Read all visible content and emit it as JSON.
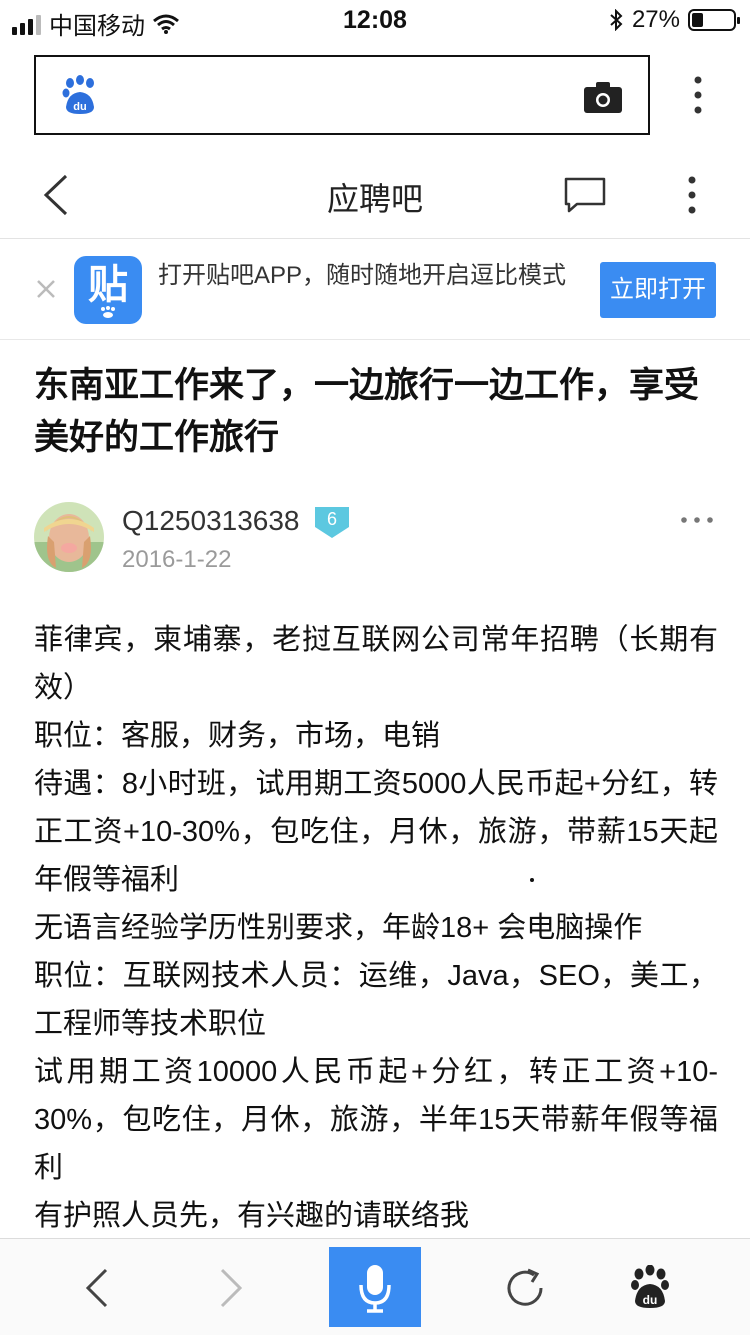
{
  "status_bar": {
    "carrier": "中国移动",
    "time": "12:08",
    "battery": "27%",
    "battery_level": 0.27
  },
  "search_bar": {
    "logo_icon": "baidu-paw-icon",
    "camera_icon": "camera-icon",
    "menu_icon": "more-vertical-icon"
  },
  "nav": {
    "title": "应聘吧",
    "back_icon": "chevron-left-icon",
    "chat_icon": "chat-bubble-icon",
    "more_icon": "more-vertical-icon"
  },
  "banner": {
    "app_icon_char": "贴",
    "text": "打开贴吧APP，随时随地开启逗比模式",
    "open_button": "立即打开"
  },
  "post": {
    "title": "东南亚工作来了，一边旅行一边工作，享受美好的工作旅行",
    "author": "Q1250313638",
    "level": "6",
    "date": "2016-1-22",
    "content": [
      "菲律宾，柬埔寨，老挝互联网公司常年招聘（长期有效）",
      "职位：客服，财务，市场，电销",
      "待遇：8小时班，试用期工资5000人民币起+分红，转正工资+10-30%，包吃住，月休，旅游，带薪15天起年假等福利",
      "无语言经验学历性别要求，年龄18+ 会电脑操作",
      "职位：互联网技术人员：运维，Java，SEO，美工，工程师等技术职位",
      "试用期工资10000人民币起+分红，转正工资+10-30%，包吃住，月休，旅游，半年15天带薪年假等福利",
      "有护照人员先，有兴趣的请联络我"
    ]
  },
  "toolbar": {
    "back_icon": "chevron-left-icon",
    "forward_icon": "chevron-right-icon",
    "mic_icon": "microphone-icon",
    "refresh_icon": "refresh-icon",
    "home_icon": "baidu-paw-icon"
  },
  "colors": {
    "accent": "#3a8cf2",
    "level_badge": "#5cc8e0",
    "muted_text": "#9a9a9a"
  }
}
